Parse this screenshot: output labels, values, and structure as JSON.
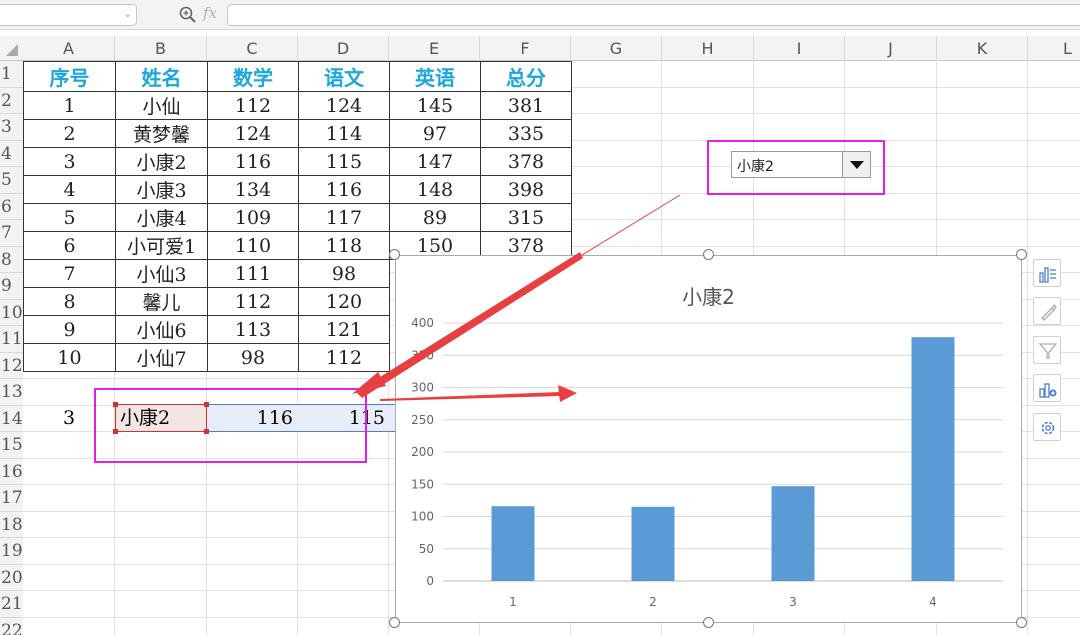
{
  "columns": [
    "A",
    "B",
    "C",
    "D",
    "E",
    "F",
    "G",
    "H",
    "I",
    "J",
    "K",
    "L"
  ],
  "rows": [
    "1",
    "2",
    "3",
    "4",
    "5",
    "6",
    "7",
    "8",
    "9",
    "10",
    "11",
    "12",
    "13",
    "14",
    "15",
    "16",
    "17",
    "18",
    "19",
    "20",
    "21",
    "22"
  ],
  "table": {
    "headers": [
      "序号",
      "姓名",
      "数学",
      "语文",
      "英语",
      "总分"
    ],
    "rows": [
      [
        "1",
        "小仙",
        "112",
        "124",
        "145",
        "381"
      ],
      [
        "2",
        "黄梦馨",
        "124",
        "114",
        "97",
        "335"
      ],
      [
        "3",
        "小康2",
        "116",
        "115",
        "147",
        "378"
      ],
      [
        "4",
        "小康3",
        "134",
        "116",
        "148",
        "398"
      ],
      [
        "5",
        "小康4",
        "109",
        "117",
        "89",
        "315"
      ],
      [
        "6",
        "小可爱1",
        "110",
        "118",
        "150",
        "378"
      ],
      [
        "7",
        "小仙3",
        "111",
        "98",
        "",
        ""
      ],
      [
        "8",
        "馨儿",
        "112",
        "120",
        "",
        ""
      ],
      [
        "9",
        "小仙6",
        "113",
        "121",
        "",
        ""
      ],
      [
        "10",
        "小仙7",
        "98",
        "112",
        "",
        ""
      ]
    ]
  },
  "lookup_row": {
    "a": "3",
    "b": "小康2",
    "c": "116",
    "d": "115"
  },
  "dropdown": {
    "selected": "小康2"
  },
  "chart_data": {
    "type": "bar",
    "title": "小康2",
    "categories": [
      "1",
      "2",
      "3",
      "4"
    ],
    "values": [
      116,
      115,
      147,
      378
    ],
    "ylim": [
      0,
      400
    ],
    "yticks": [
      0,
      50,
      100,
      150,
      200,
      250,
      300,
      350,
      400
    ],
    "grid": true,
    "bar_color": "#5b9bd5"
  },
  "colors": {
    "header_text": "#1aa7dc",
    "highlight": "#e020e8",
    "arrow": "#e84040"
  }
}
